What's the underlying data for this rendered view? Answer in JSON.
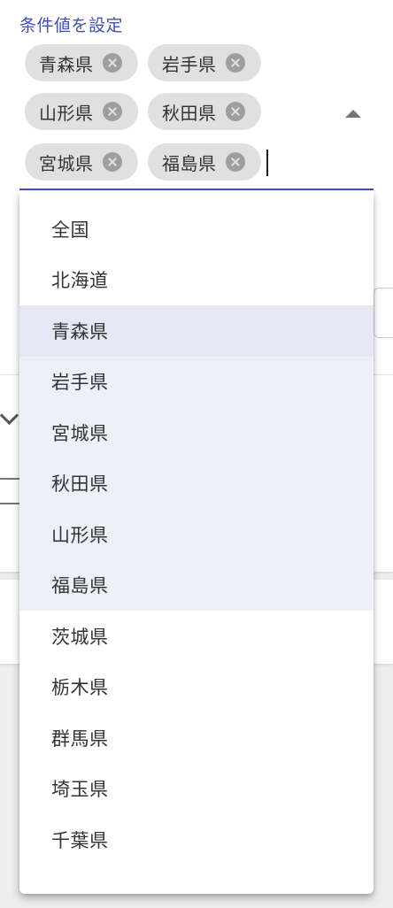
{
  "field": {
    "label": "条件値を設定",
    "chips": [
      {
        "label": "青森県"
      },
      {
        "label": "岩手県"
      },
      {
        "label": "山形県"
      },
      {
        "label": "秋田県"
      },
      {
        "label": "宮城県"
      },
      {
        "label": "福島県"
      }
    ]
  },
  "dropdown": {
    "options": [
      {
        "label": "全国",
        "selected": false
      },
      {
        "label": "北海道",
        "selected": false
      },
      {
        "label": "青森県",
        "selected": true,
        "focused": true
      },
      {
        "label": "岩手県",
        "selected": true
      },
      {
        "label": "宮城県",
        "selected": true
      },
      {
        "label": "秋田県",
        "selected": true
      },
      {
        "label": "山形県",
        "selected": true
      },
      {
        "label": "福島県",
        "selected": true
      },
      {
        "label": "茨城県",
        "selected": false
      },
      {
        "label": "栃木県",
        "selected": false
      },
      {
        "label": "群馬県",
        "selected": false
      },
      {
        "label": "埼玉県",
        "selected": false
      },
      {
        "label": "千葉県",
        "selected": false
      }
    ]
  },
  "colors": {
    "accent": "#3f51b5",
    "chip_bg": "#e0e0e0",
    "selected_bg": "#eef0f8",
    "focused_bg": "#e6e8f5"
  },
  "icons": {
    "chip_remove": "cancel-circle-icon",
    "dropdown_toggle": "arrow-up-icon"
  }
}
